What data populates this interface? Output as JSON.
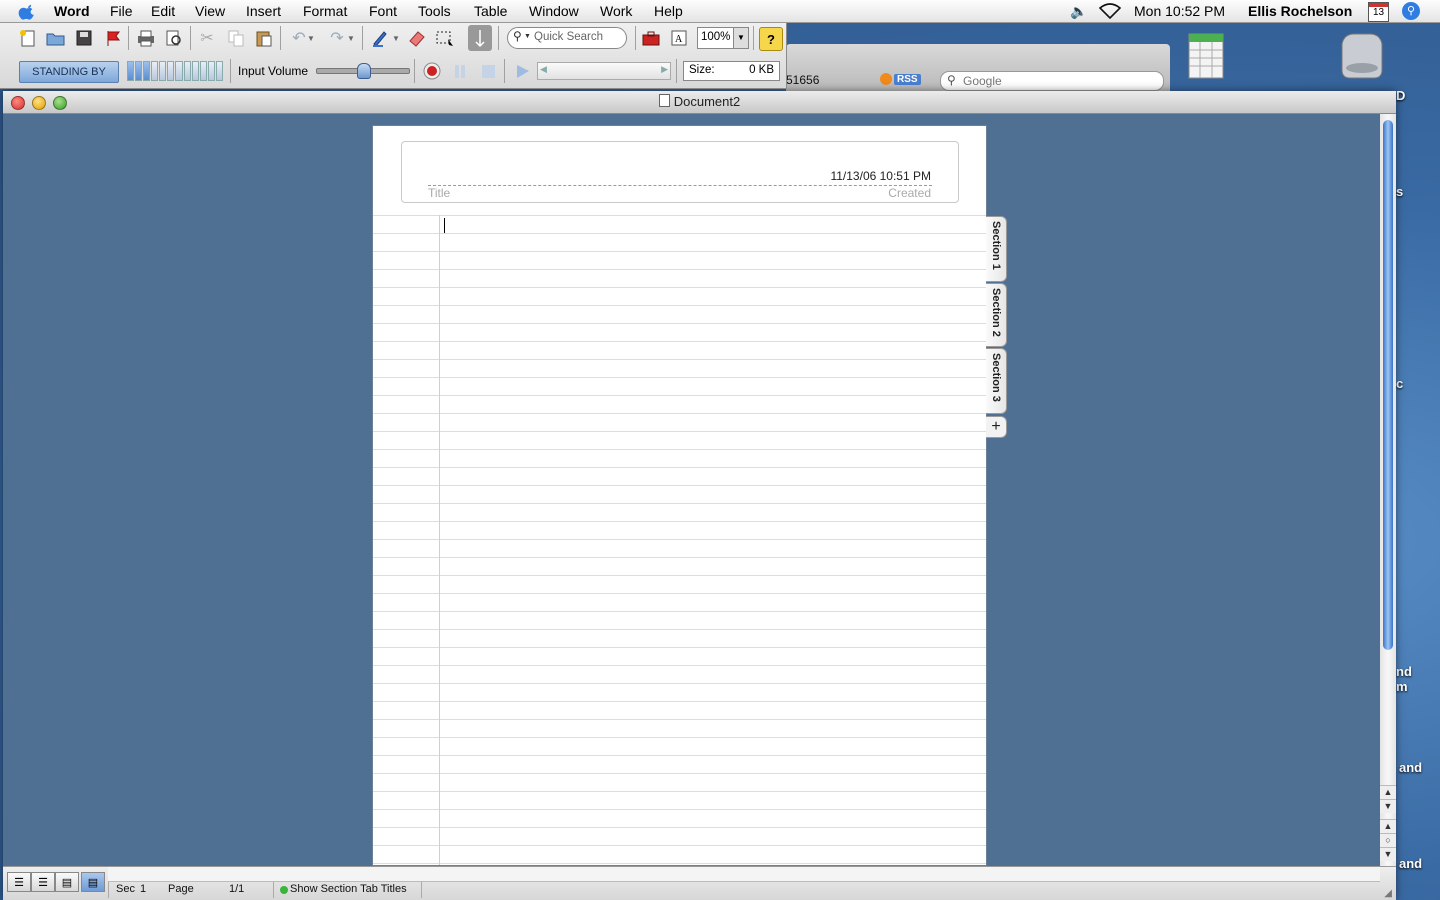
{
  "menubar": {
    "app_name": "Word",
    "items": [
      "File",
      "Edit",
      "View",
      "Insert",
      "Format",
      "Font",
      "Tools",
      "Table",
      "Window",
      "Work",
      "Help"
    ],
    "clock": "Mon 10:52 PM",
    "user": "Ellis Rochelson",
    "calendar_day": "13"
  },
  "toolbar": {
    "quick_search_placeholder": "Quick Search",
    "zoom": "100%",
    "status_button": "STANDING BY",
    "input_volume_label": "Input Volume",
    "size_label": "Size:",
    "size_value": "0 KB"
  },
  "background_window": {
    "address_fragment": "51656",
    "rss_label": "RSS",
    "search_placeholder": "Google"
  },
  "desktop": {
    "fragments": [
      "D",
      "s",
      "c",
      "nd",
      "m",
      "and",
      "and"
    ]
  },
  "document": {
    "window_title": "Document2",
    "header": {
      "created_value": "11/13/06 10:51 PM",
      "title_placeholder": "Title",
      "created_label": "Created"
    },
    "section_tabs": [
      "Section 1",
      "Section 2",
      "Section 3"
    ],
    "add_tab": "+"
  },
  "statusbar": {
    "section": "Sec",
    "section_num": "1",
    "page_label": "Page",
    "page_value": "1/1",
    "toggle_label": "Show Section Tab Titles"
  },
  "colors": {
    "desktop_blue": "#3d6a9c",
    "window_bg": "#4f6f93",
    "rule_line": "#c6e4f4",
    "scroll_thumb": "#3a72c8",
    "status_green": "#3bb43b"
  }
}
